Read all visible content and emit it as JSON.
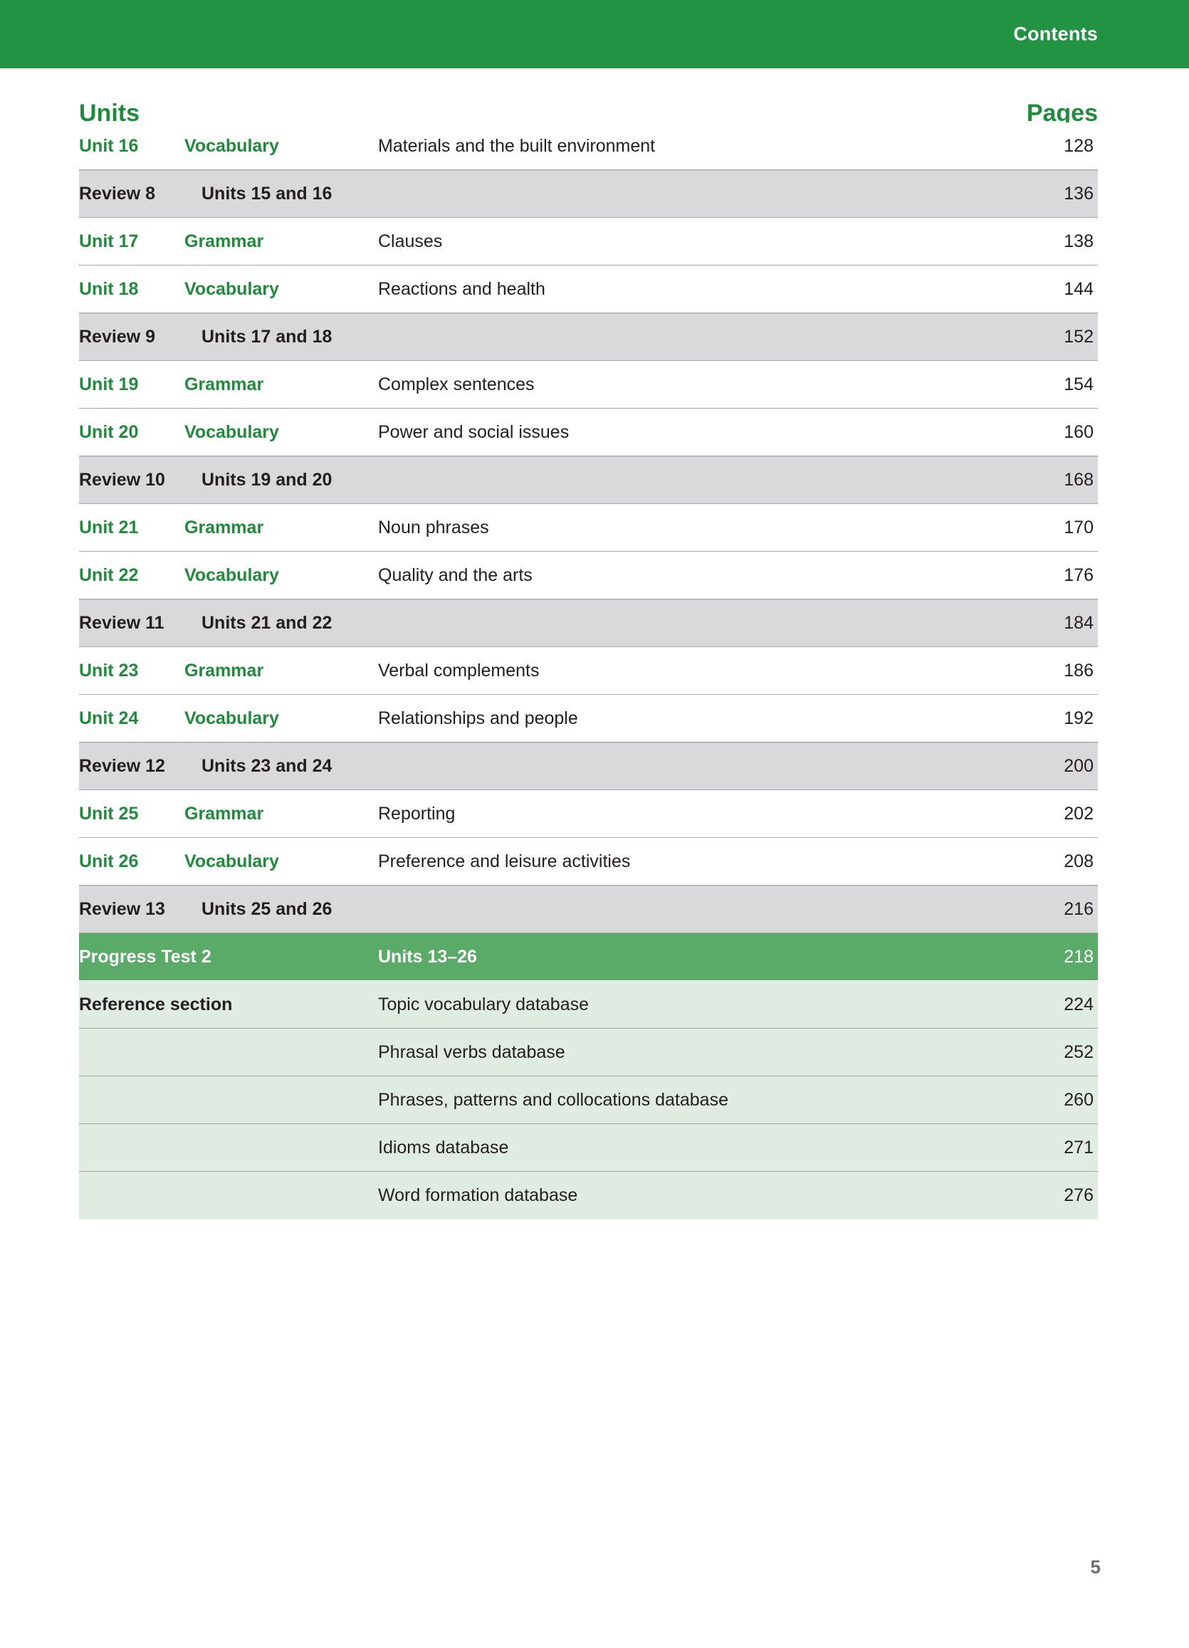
{
  "header": {
    "title": "Contents",
    "band_color": "#229342"
  },
  "column_headings": {
    "units": "Units",
    "pages": "Pages"
  },
  "colors": {
    "brand_green": "#229342",
    "label_green": "#1f8c3c",
    "progress_row_green": "#5aab68",
    "reference_row_green": "#e0ebe1",
    "review_row_gray": "#d9d9db",
    "rule_gray": "#a8a8a8",
    "body_text": "#231f20",
    "folio_gray": "#6d6e71"
  },
  "rows": [
    {
      "type": "unit",
      "code": "Unit 16",
      "kind": "Vocabulary",
      "desc": "Materials and the built environment",
      "page": "128"
    },
    {
      "type": "review",
      "code": "Review 8",
      "kind": "Units 15 and 16",
      "desc": "",
      "page": "136"
    },
    {
      "type": "unit",
      "code": "Unit 17",
      "kind": "Grammar",
      "desc": "Clauses",
      "page": "138"
    },
    {
      "type": "unit",
      "code": "Unit 18",
      "kind": "Vocabulary",
      "desc": "Reactions and health",
      "page": "144"
    },
    {
      "type": "review",
      "code": "Review 9",
      "kind": "Units 17 and 18",
      "desc": "",
      "page": "152"
    },
    {
      "type": "unit",
      "code": "Unit 19",
      "kind": "Grammar",
      "desc": "Complex sentences",
      "page": "154"
    },
    {
      "type": "unit",
      "code": "Unit 20",
      "kind": "Vocabulary",
      "desc": "Power and social issues",
      "page": "160"
    },
    {
      "type": "review",
      "code": "Review 10",
      "kind": "Units 19 and 20",
      "desc": "",
      "page": "168"
    },
    {
      "type": "unit",
      "code": "Unit 21",
      "kind": "Grammar",
      "desc": "Noun phrases",
      "page": "170"
    },
    {
      "type": "unit",
      "code": "Unit 22",
      "kind": "Vocabulary",
      "desc": "Quality and the arts",
      "page": "176"
    },
    {
      "type": "review",
      "code": "Review 11",
      "kind": "Units 21 and 22",
      "desc": "",
      "page": "184"
    },
    {
      "type": "unit",
      "code": "Unit 23",
      "kind": "Grammar",
      "desc": "Verbal complements",
      "page": "186"
    },
    {
      "type": "unit",
      "code": "Unit 24",
      "kind": "Vocabulary",
      "desc": "Relationships and people",
      "page": "192"
    },
    {
      "type": "review",
      "code": "Review 12",
      "kind": "Units 23 and 24",
      "desc": "",
      "page": "200"
    },
    {
      "type": "unit",
      "code": "Unit 25",
      "kind": "Grammar",
      "desc": "Reporting",
      "page": "202"
    },
    {
      "type": "unit",
      "code": "Unit 26",
      "kind": "Vocabulary",
      "desc": "Preference and leisure activities",
      "page": "208"
    },
    {
      "type": "review",
      "code": "Review 13",
      "kind": "Units 25 and 26",
      "desc": "",
      "page": "216"
    },
    {
      "type": "progress",
      "code": "Progress Test 2",
      "kind": "",
      "desc": "Units 13–26",
      "page": "218"
    },
    {
      "type": "reference",
      "code": "Reference section",
      "kind": "",
      "desc": "Topic vocabulary database",
      "page": "224"
    },
    {
      "type": "reference",
      "code": "",
      "kind": "",
      "desc": "Phrasal verbs database",
      "page": "252"
    },
    {
      "type": "reference",
      "code": "",
      "kind": "",
      "desc": "Phrases, patterns and collocations database",
      "page": "260"
    },
    {
      "type": "reference",
      "code": "",
      "kind": "",
      "desc": "Idioms database",
      "page": "271"
    },
    {
      "type": "reference",
      "code": "",
      "kind": "",
      "desc": "Word formation database",
      "page": "276"
    }
  ],
  "footer": {
    "folio": "5"
  }
}
